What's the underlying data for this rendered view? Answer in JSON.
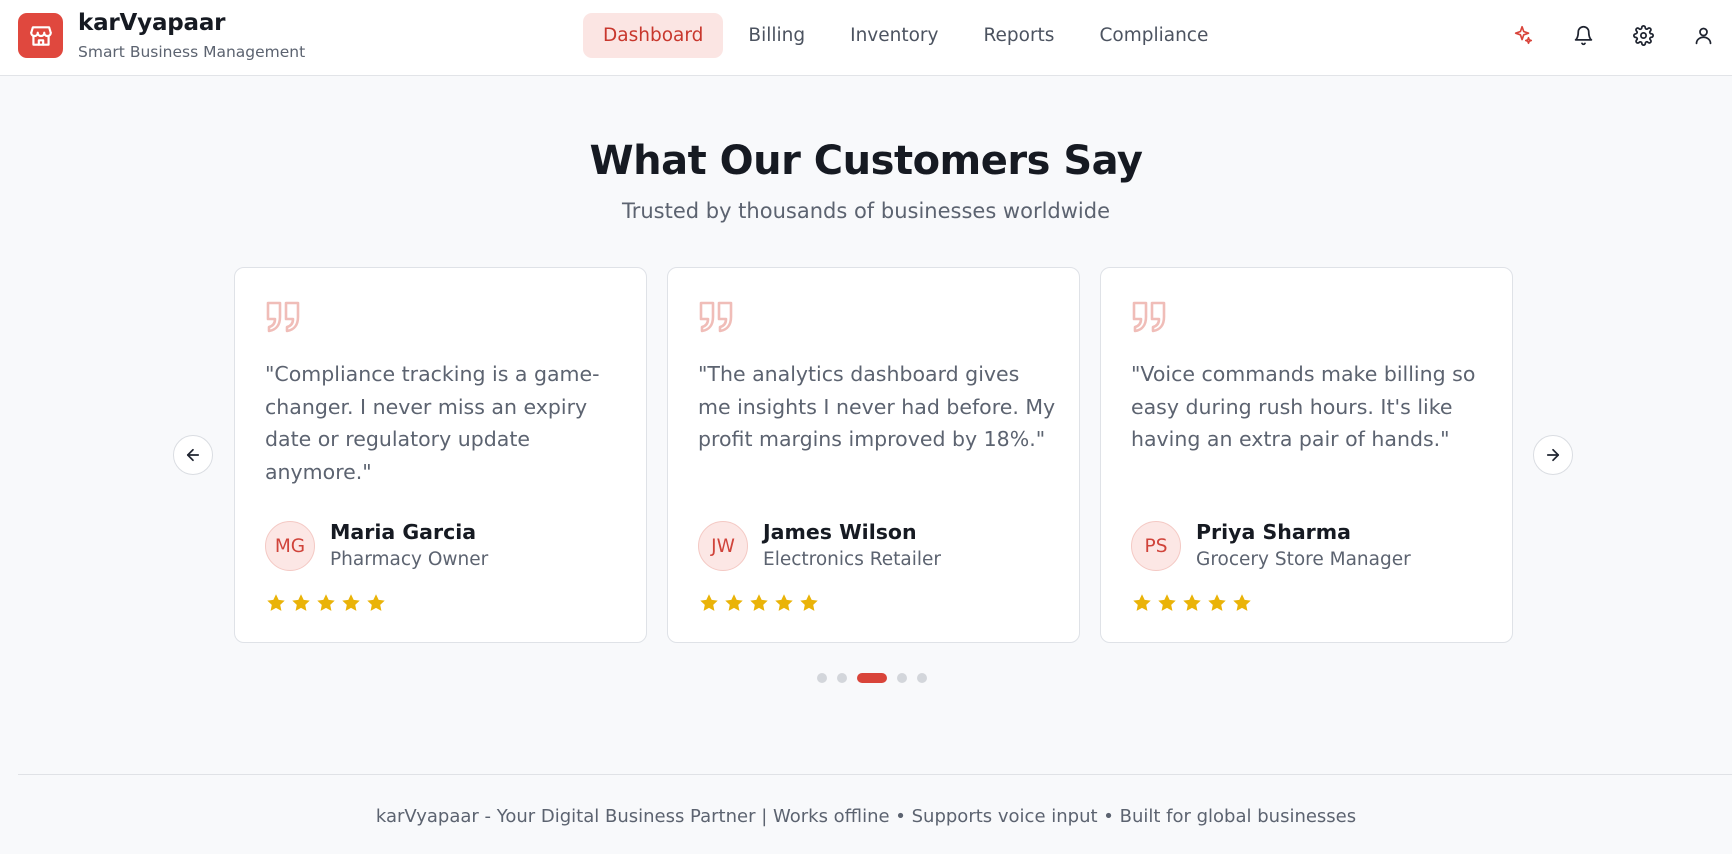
{
  "brand": {
    "name": "karVyapaar",
    "tagline": "Smart Business Management"
  },
  "nav": [
    {
      "label": "Dashboard",
      "active": true
    },
    {
      "label": "Billing",
      "active": false
    },
    {
      "label": "Inventory",
      "active": false
    },
    {
      "label": "Reports",
      "active": false
    },
    {
      "label": "Compliance",
      "active": false
    }
  ],
  "header_icons": [
    "sparkle-icon",
    "bell-icon",
    "gear-icon",
    "user-icon"
  ],
  "section": {
    "title": "What Our Customers Say",
    "subtitle": "Trusted by thousands of businesses worldwide"
  },
  "testimonials": [
    {
      "quote": "\"Compliance tracking is a game-changer. I never miss an expiry date or regulatory update anymore.\"",
      "initials": "MG",
      "name": "Maria Garcia",
      "role": "Pharmacy Owner",
      "rating": 5
    },
    {
      "quote": "\"The analytics dashboard gives me insights I never had before. My profit margins improved by 18%.\"",
      "initials": "JW",
      "name": "James Wilson",
      "role": "Electronics Retailer",
      "rating": 5
    },
    {
      "quote": "\"Voice commands make billing so easy during rush hours. It's like having an extra pair of hands.\"",
      "initials": "PS",
      "name": "Priya Sharma",
      "role": "Grocery Store Manager",
      "rating": 5
    }
  ],
  "carousel": {
    "page_count": 5,
    "active_page": 3
  },
  "footer": {
    "text": "karVyapaar - Your Digital Business Partner | Works offline • Supports voice input • Built for global businesses"
  },
  "colors": {
    "accent": "#d9443a",
    "accent_light": "#fbe5e3",
    "star": "#eab308",
    "background": "#f8f9fb"
  }
}
